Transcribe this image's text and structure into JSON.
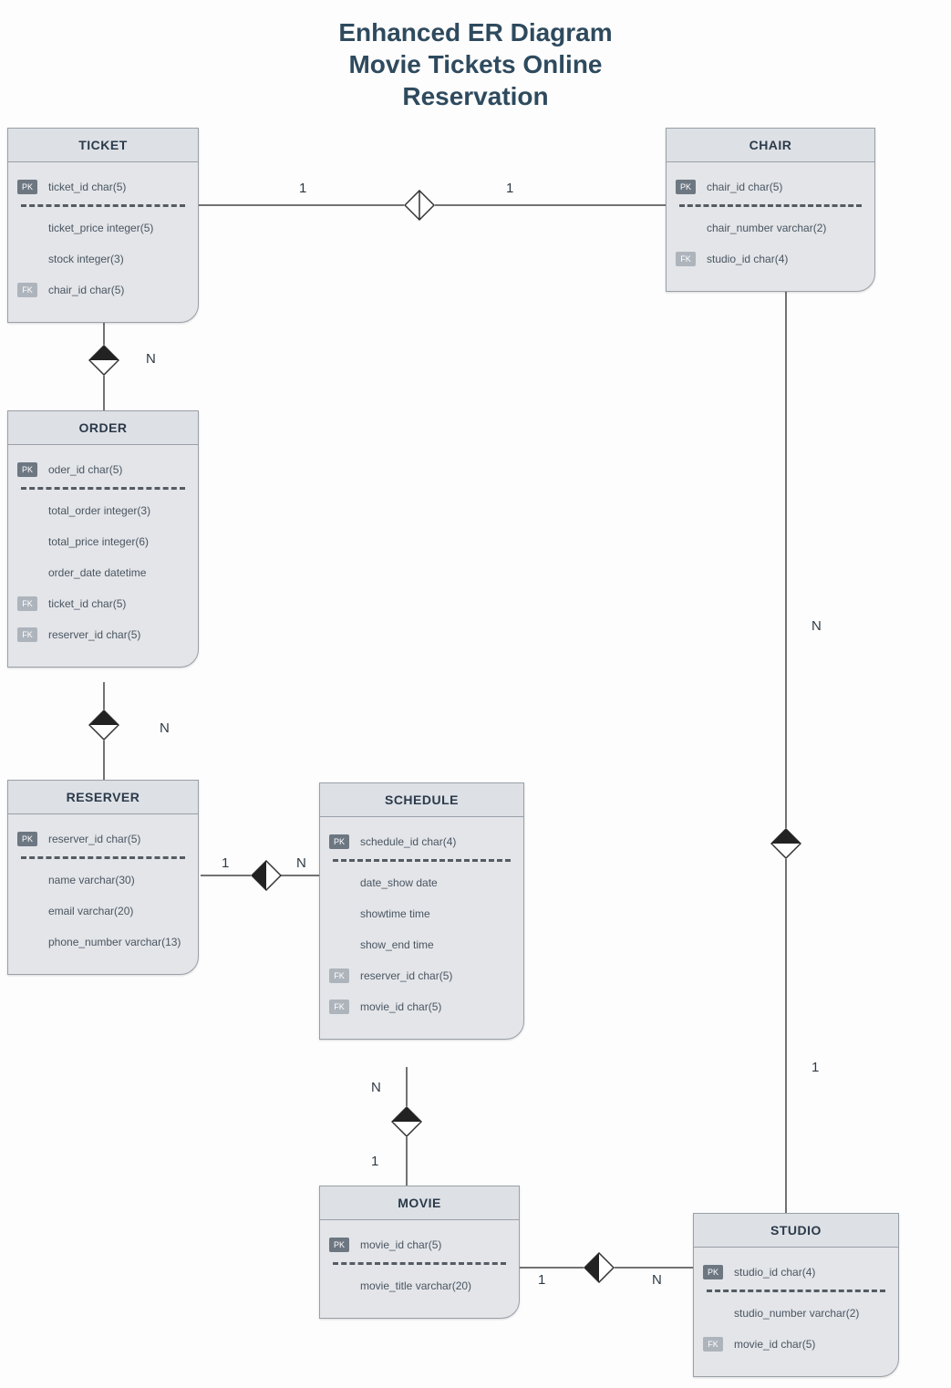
{
  "title_line1": "Enhanced ER Diagram",
  "title_line2": "Movie Tickets Online",
  "title_line3": "Reservation",
  "key_labels": {
    "pk": "PK",
    "fk": "FK"
  },
  "entities": {
    "ticket": {
      "name": "TICKET",
      "attrs": [
        {
          "key": "pk",
          "text": "ticket_id char(5)"
        },
        {
          "key": "",
          "text": "ticket_price integer(5)"
        },
        {
          "key": "",
          "text": "stock integer(3)"
        },
        {
          "key": "fk",
          "text": "chair_id char(5)"
        }
      ]
    },
    "chair": {
      "name": "CHAIR",
      "attrs": [
        {
          "key": "pk",
          "text": "chair_id char(5)"
        },
        {
          "key": "",
          "text": "chair_number varchar(2)"
        },
        {
          "key": "fk",
          "text": "studio_id char(4)"
        }
      ]
    },
    "order": {
      "name": "ORDER",
      "attrs": [
        {
          "key": "pk",
          "text": "oder_id char(5)"
        },
        {
          "key": "",
          "text": "total_order integer(3)"
        },
        {
          "key": "",
          "text": "total_price integer(6)"
        },
        {
          "key": "",
          "text": "order_date datetime"
        },
        {
          "key": "fk",
          "text": "ticket_id char(5)"
        },
        {
          "key": "fk",
          "text": "reserver_id char(5)"
        }
      ]
    },
    "reserver": {
      "name": "RESERVER",
      "attrs": [
        {
          "key": "pk",
          "text": "reserver_id char(5)"
        },
        {
          "key": "",
          "text": "name varchar(30)"
        },
        {
          "key": "",
          "text": "email varchar(20)"
        },
        {
          "key": "",
          "text": "phone_number varchar(13)"
        }
      ]
    },
    "schedule": {
      "name": "SCHEDULE",
      "attrs": [
        {
          "key": "pk",
          "text": "schedule_id char(4)"
        },
        {
          "key": "",
          "text": "date_show date"
        },
        {
          "key": "",
          "text": "showtime time"
        },
        {
          "key": "",
          "text": "show_end time"
        },
        {
          "key": "fk",
          "text": "reserver_id char(5)"
        },
        {
          "key": "fk",
          "text": "movie_id char(5)"
        }
      ]
    },
    "movie": {
      "name": "MOVIE",
      "attrs": [
        {
          "key": "pk",
          "text": "movie_id char(5)"
        },
        {
          "key": "",
          "text": "movie_title varchar(20)"
        }
      ]
    },
    "studio": {
      "name": "STUDIO",
      "attrs": [
        {
          "key": "pk",
          "text": "studio_id char(4)"
        },
        {
          "key": "",
          "text": "studio_number varchar(2)"
        },
        {
          "key": "fk",
          "text": "movie_id char(5)"
        }
      ]
    }
  },
  "cardinalities": {
    "ticket_chair_left": "1",
    "ticket_chair_right": "1",
    "ticket_order": "N",
    "order_reserver": "N",
    "reserver_schedule_left": "1",
    "reserver_schedule_right": "N",
    "schedule_movie_top": "N",
    "schedule_movie_bot": "1",
    "movie_studio_left": "1",
    "movie_studio_right": "N",
    "chair_studio_top": "N",
    "chair_studio_bot": "1"
  }
}
